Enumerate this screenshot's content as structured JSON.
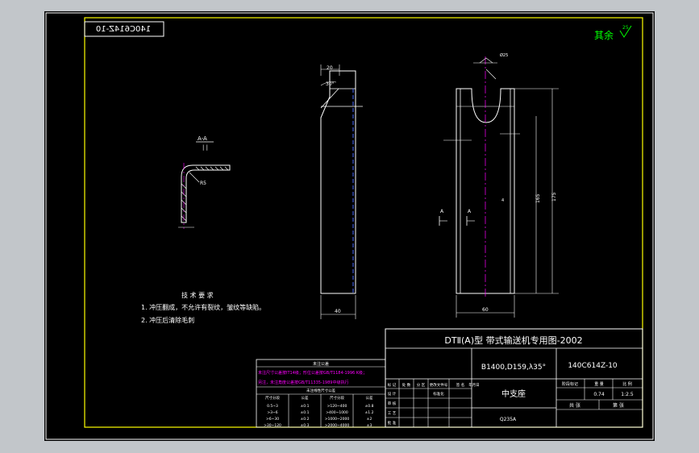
{
  "drawing": {
    "mirrored_code": "140C614Z-10",
    "surface_finish": "其余",
    "surface_symbol_value": "25",
    "technical_requirements": {
      "title": "技 术 要 求",
      "items": [
        "1. 冲压翻成，不允许有裂纹，皱纹等缺陷。",
        "2. 冲压后清除毛刺"
      ]
    },
    "section_view": {
      "label": "A-A",
      "radius": "R5"
    },
    "side_view": {
      "dim_top": "20",
      "dim_angle": "30°",
      "dim_bottom": "40"
    },
    "front_view": {
      "dim_width": "60",
      "dim_height_inner": "165",
      "dim_height_outer": "175",
      "section_mark_left": "A",
      "section_mark_right": "A",
      "top_note": "Ø25",
      "side_note": "4"
    }
  },
  "title_block": {
    "project": "DTⅡ(A)型  带式输送机专用图-2002",
    "spec": "B1400,D159,λ35°",
    "drawing_no": "140C614Z-10",
    "part_name": "中支座",
    "material": "Q235A",
    "scale_header": "比 例",
    "weight_header": "重 量",
    "stage_header": "阶段标记",
    "weight_value": "0.74",
    "scale_value": "1:2.5",
    "sheet_total": "共  张",
    "sheet_no": "第  张",
    "revision_headers": [
      "标 记",
      "处 数",
      "分 区",
      "更改文件号",
      "签 名",
      "年月日"
    ],
    "role_labels": [
      "设 计",
      "审 核",
      "工 艺",
      "批 准"
    ],
    "standardization": "标准化"
  },
  "tolerance_table": {
    "title": "未注公差",
    "notes": [
      "未注尺寸公差按IT14级；形位公差按GB/T1184-1996 K级；",
      "另注，未注角度公差按GB/T11335-1989中级执行"
    ],
    "header_caption": "未注线性尺寸公差",
    "columns": [
      "尺寸分段",
      "公差",
      "尺寸分段",
      "公差"
    ],
    "rows": [
      [
        "0.5~3",
        "±0.1",
        ">120~400",
        "±0.8"
      ],
      [
        ">3~6",
        "±0.1",
        ">400~1000",
        "±1.2"
      ],
      [
        ">6~30",
        "±0.2",
        ">1000~2000",
        "±2"
      ],
      [
        ">30~120",
        "±0.3",
        ">2000~4000",
        "±3"
      ]
    ]
  }
}
